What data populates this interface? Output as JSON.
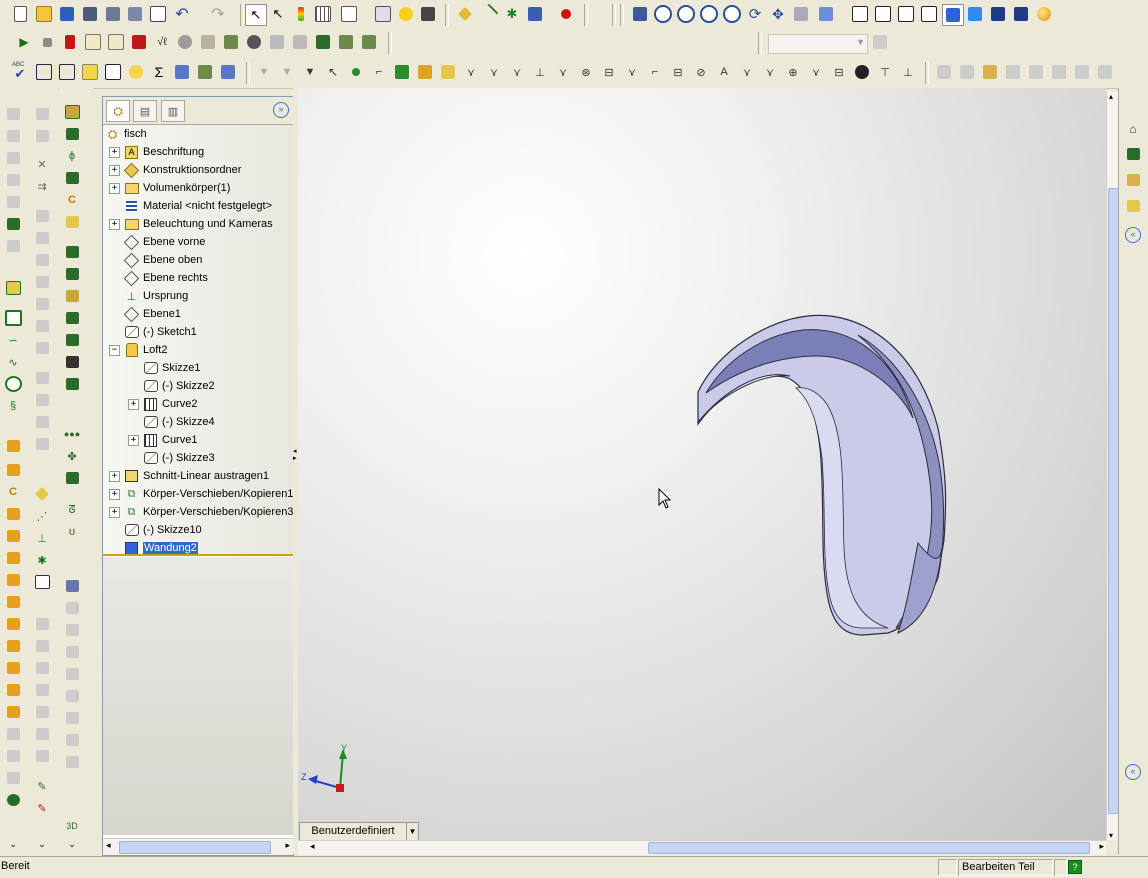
{
  "toolbars": {
    "standard": {
      "buttons": [
        "new-file-icon",
        "open-icon",
        "save-icon",
        "print-icon",
        "properties-icon",
        "options-icon",
        "print-preview-icon",
        "undo-icon",
        "redo-icon",
        "select-icon",
        "select-filter-icon",
        "traffic-light-icon",
        "grid-icon",
        "view-palette-icon",
        "assembly-icon",
        "help-icon",
        "camera-icon",
        "sketch-icon",
        "line-icon",
        "point-icon",
        "smart-dimension-icon",
        "record-icon"
      ]
    },
    "view": {
      "buttons": [
        "previous-view-icon",
        "zoom-fit-icon",
        "zoom-area-icon",
        "zoom-in-out-icon",
        "zoom-selection-icon",
        "rotate-icon",
        "pan-icon",
        "section-view-icon",
        "view-orientation-icon",
        "wireframe-icon",
        "hidden-lines-visible-icon",
        "hidden-lines-removed-icon",
        "draft-quality-icon",
        "shaded-edges-icon",
        "shaded-icon",
        "shadows-icon",
        "perspective-icon",
        "render-icon"
      ]
    },
    "macro": {
      "buttons": [
        "run-macro-icon",
        "stop-macro-icon",
        "record-macro-icon",
        "new-macro-icon",
        "edit-macro-icon",
        "delete-icon",
        "check-icon",
        "mate-icon",
        "measure-icon",
        "tools-icon",
        "simulation-icon",
        "add-in-icon",
        "add-in2-icon",
        "library-icon",
        "toolbox-icon",
        "design-icon"
      ],
      "combo_value": ""
    },
    "sketch_tools": {
      "abc_label": "ABC"
    }
  },
  "feature_manager": {
    "tabs": [
      "feature-manager-tab-icon",
      "property-manager-tab-icon",
      "configuration-manager-tab-icon"
    ],
    "expand_glyph": "»",
    "root": "fisch",
    "items": [
      {
        "label": "Beschriftung",
        "icon": "annotations-icon",
        "expander": "+",
        "depth": 1
      },
      {
        "label": "Konstruktionsordner",
        "icon": "design-binder-icon",
        "expander": "+",
        "depth": 1
      },
      {
        "label": "Volumenkörper(1)",
        "icon": "solid-bodies-folder-icon",
        "expander": "+",
        "depth": 1
      },
      {
        "label": "Material <nicht festgelegt>",
        "icon": "material-icon",
        "expander": "",
        "depth": 1
      },
      {
        "label": "Beleuchtung und Kameras",
        "icon": "lighting-folder-icon",
        "expander": "+",
        "depth": 1
      },
      {
        "label": "Ebene vorne",
        "icon": "plane-icon",
        "expander": "",
        "depth": 1
      },
      {
        "label": "Ebene oben",
        "icon": "plane-icon",
        "expander": "",
        "depth": 1
      },
      {
        "label": "Ebene rechts",
        "icon": "plane-icon",
        "expander": "",
        "depth": 1
      },
      {
        "label": "Ursprung",
        "icon": "origin-icon",
        "expander": "",
        "depth": 1
      },
      {
        "label": "Ebene1",
        "icon": "plane-icon",
        "expander": "",
        "depth": 1
      },
      {
        "label": "(-) Sketch1",
        "icon": "sketch-icon",
        "expander": "",
        "depth": 1
      },
      {
        "label": "Loft2",
        "icon": "loft-icon",
        "expander": "−",
        "depth": 1
      },
      {
        "label": "Skizze1",
        "icon": "sketch-icon",
        "expander": "",
        "depth": 2
      },
      {
        "label": "(-) Skizze2",
        "icon": "sketch-icon",
        "expander": "",
        "depth": 2
      },
      {
        "label": "Curve2",
        "icon": "curve-icon",
        "expander": "+",
        "depth": 2
      },
      {
        "label": "(-) Skizze4",
        "icon": "sketch-icon",
        "expander": "",
        "depth": 2
      },
      {
        "label": "Curve1",
        "icon": "curve-icon",
        "expander": "+",
        "depth": 2
      },
      {
        "label": "(-) Skizze3",
        "icon": "sketch-icon",
        "expander": "",
        "depth": 2
      },
      {
        "label": "Schnitt-Linear austragen1",
        "icon": "cut-extrude-icon",
        "expander": "+",
        "depth": 1
      },
      {
        "label": "Körper-Verschieben/Kopieren1",
        "icon": "move-copy-body-icon",
        "expander": "+",
        "depth": 1
      },
      {
        "label": "Körper-Verschieben/Kopieren3",
        "icon": "move-copy-body-icon",
        "expander": "+",
        "depth": 1
      },
      {
        "label": "(-) Skizze10",
        "icon": "sketch-icon",
        "expander": "",
        "depth": 1
      },
      {
        "label": "Wandung2",
        "icon": "shell-icon",
        "expander": "",
        "depth": 1,
        "selected": true
      }
    ]
  },
  "graphics": {
    "view_tab_label": "Benutzerdefiniert",
    "triad": {
      "x_label": "",
      "y_label": "Y",
      "z_label": "Z"
    },
    "colors": {
      "part_fill": "#c9cbe8",
      "part_shadow": "#8d90be",
      "part_edge": "#2b2b40",
      "background_light": "#ffffff",
      "background_dark": "#c4c4c4"
    }
  },
  "task_pane": {
    "buttons": [
      "home-icon",
      "resources-icon",
      "design-library-icon",
      "file-explorer-icon",
      "collapse-left-icon"
    ],
    "bottom_glyph": "«"
  },
  "statusbar": {
    "left_text": "Bereit",
    "mode_text": "Bearbeiten Teil",
    "help_glyph": "?"
  }
}
